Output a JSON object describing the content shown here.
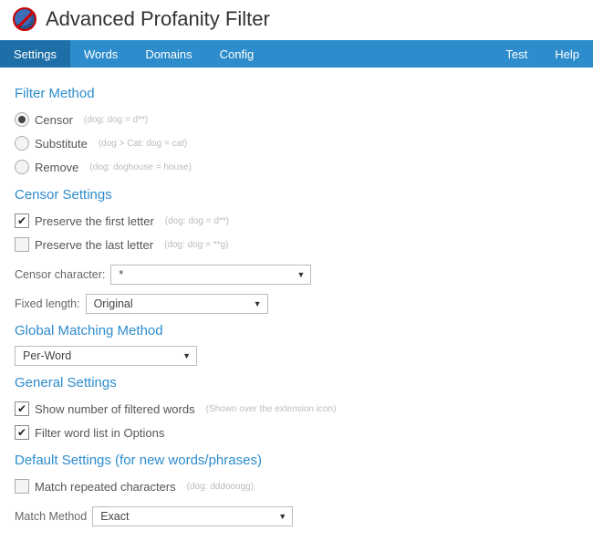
{
  "header": {
    "title": "Advanced Profanity Filter"
  },
  "tabs": {
    "items": [
      "Settings",
      "Words",
      "Domains",
      "Config"
    ],
    "right": [
      "Test",
      "Help"
    ],
    "activeIndex": 0
  },
  "filterMethod": {
    "heading": "Filter Method",
    "options": [
      {
        "label": "Censor",
        "hint": "(dog: dog = d**)",
        "selected": true
      },
      {
        "label": "Substitute",
        "hint": "(dog > Cat: dog = cat)",
        "selected": false
      },
      {
        "label": "Remove",
        "hint": "(dog: doghouse = house)",
        "selected": false
      }
    ]
  },
  "censorSettings": {
    "heading": "Censor Settings",
    "preserveFirst": {
      "label": "Preserve the first letter",
      "hint": "(dog: dog = d**)",
      "checked": true
    },
    "preserveLast": {
      "label": "Preserve the last letter",
      "hint": "(dog: dog = **g)",
      "checked": false
    },
    "censorChar": {
      "label": "Censor character:",
      "value": "*"
    },
    "fixedLength": {
      "label": "Fixed length:",
      "value": "Original"
    }
  },
  "globalMatching": {
    "heading": "Global Matching Method",
    "value": "Per-Word"
  },
  "generalSettings": {
    "heading": "General Settings",
    "showCount": {
      "label": "Show number of filtered words",
      "hint": "(Shown over the extension icon)",
      "checked": true
    },
    "filterList": {
      "label": "Filter word list in Options",
      "checked": true
    }
  },
  "defaultSettings": {
    "heading": "Default Settings (for new words/phrases)",
    "matchRepeated": {
      "label": "Match repeated characters",
      "hint": "(dog: dddooogg)",
      "checked": false
    },
    "matchMethod": {
      "label": "Match Method",
      "value": "Exact"
    }
  }
}
